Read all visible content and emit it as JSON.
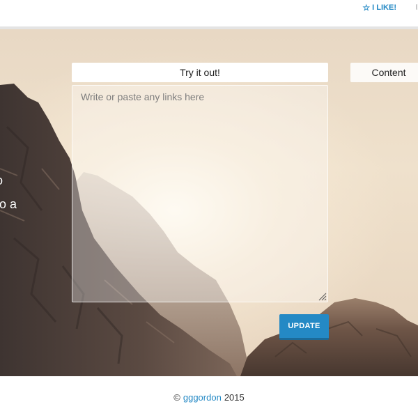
{
  "header": {
    "like_label": "I LIKE!",
    "like_icon": "star-outline-icon"
  },
  "hero": {
    "left_text_line1": "o",
    "left_text_line2": "to a"
  },
  "panel": {
    "title": "Try it out!",
    "textarea_placeholder": "Write or paste any links here",
    "textarea_value": "",
    "update_label": "UPDATE"
  },
  "content_tab": {
    "label": "Content"
  },
  "footer": {
    "copyright_symbol": "©",
    "author": "gggordon",
    "year": "2015"
  },
  "colors": {
    "accent": "#2489c5"
  }
}
